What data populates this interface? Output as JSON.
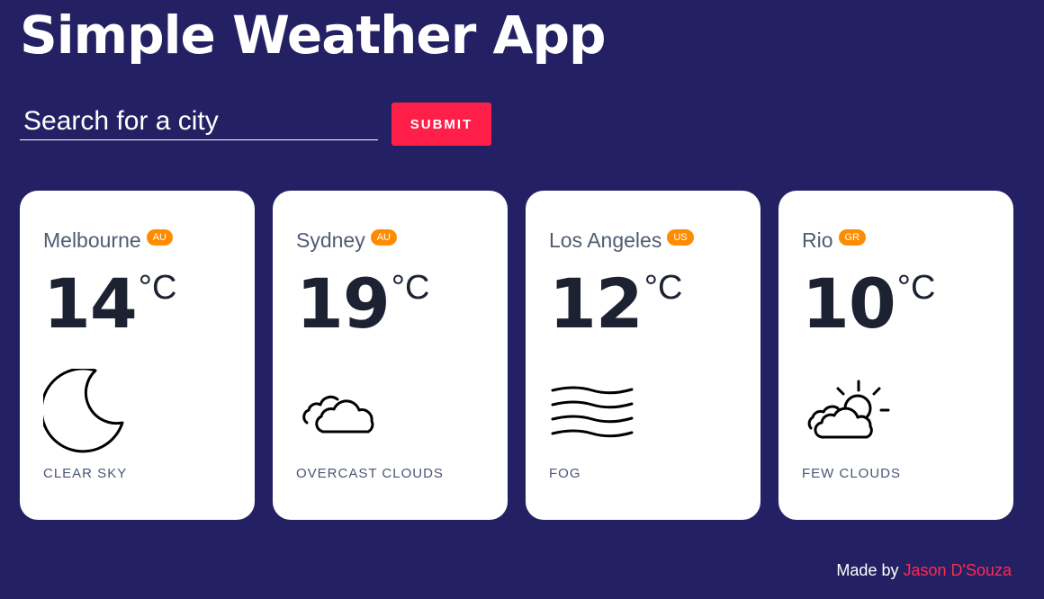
{
  "app": {
    "title": "Simple Weather App"
  },
  "search": {
    "placeholder": "Search for a city",
    "value": "",
    "submit_label": "SUBMIT"
  },
  "colors": {
    "background": "#232164",
    "accent": "#ff1f48",
    "badge": "#ff8c00",
    "card": "#ffffff"
  },
  "cities": [
    {
      "name": "Melbourne",
      "country": "AU",
      "temp": "14",
      "unit": "°C",
      "condition": "CLEAR SKY",
      "icon": "moon-icon"
    },
    {
      "name": "Sydney",
      "country": "AU",
      "temp": "19",
      "unit": "°C",
      "condition": "OVERCAST CLOUDS",
      "icon": "clouds-icon"
    },
    {
      "name": "Los Angeles",
      "country": "US",
      "temp": "12",
      "unit": "°C",
      "condition": "FOG",
      "icon": "fog-icon"
    },
    {
      "name": "Rio",
      "country": "GR",
      "temp": "10",
      "unit": "°C",
      "condition": "FEW CLOUDS",
      "icon": "sun-behind-clouds-icon"
    }
  ],
  "footer": {
    "prefix": "Made by",
    "author": "Jason D'Souza"
  }
}
